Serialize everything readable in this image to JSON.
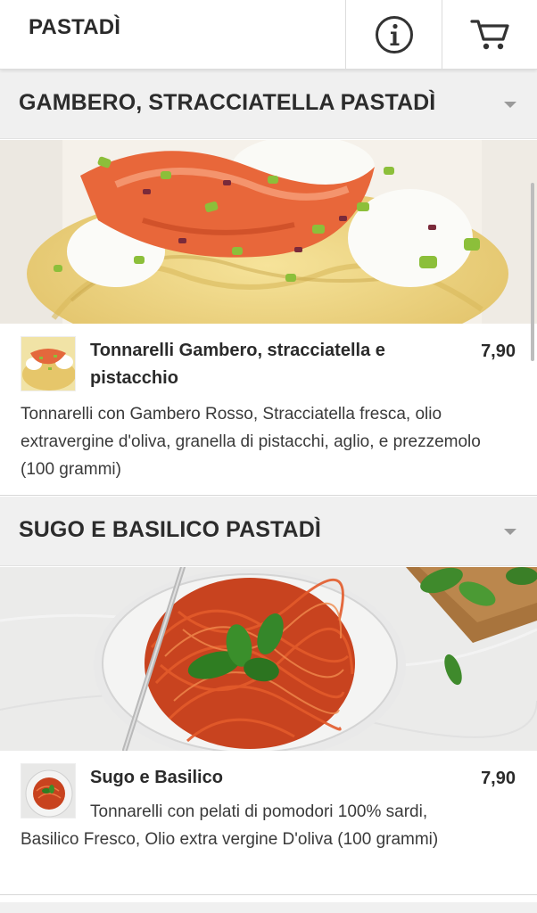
{
  "header": {
    "brand": "PASTADÌ",
    "info_icon": "info-icon",
    "cart_icon": "cart-icon"
  },
  "categories": [
    {
      "title": "GAMBERO, STRACCIATELLA PASTADÌ",
      "items": [
        {
          "name": "Tonnarelli Gambero, stracciatella e pistacchio",
          "price": "7,90",
          "description": "Tonnarelli con Gambero Rosso, Stracciatella fresca, olio extravergine d'oliva, granella di pistacchi, aglio, e prezzemolo (100 grammi)"
        }
      ]
    },
    {
      "title": "SUGO E BASILICO PASTADÌ",
      "items": [
        {
          "name": "Sugo e Basilico",
          "price": "7,90",
          "description": "Tonnarelli con pelati di pomodori 100% sardi, Basilico Fresco, Olio extra vergine D'oliva (100 grammi)"
        }
      ]
    }
  ],
  "colors": {
    "category_bg": "#f0f0f0",
    "text": "#2a2a2a",
    "divider": "#dcdcdc"
  }
}
